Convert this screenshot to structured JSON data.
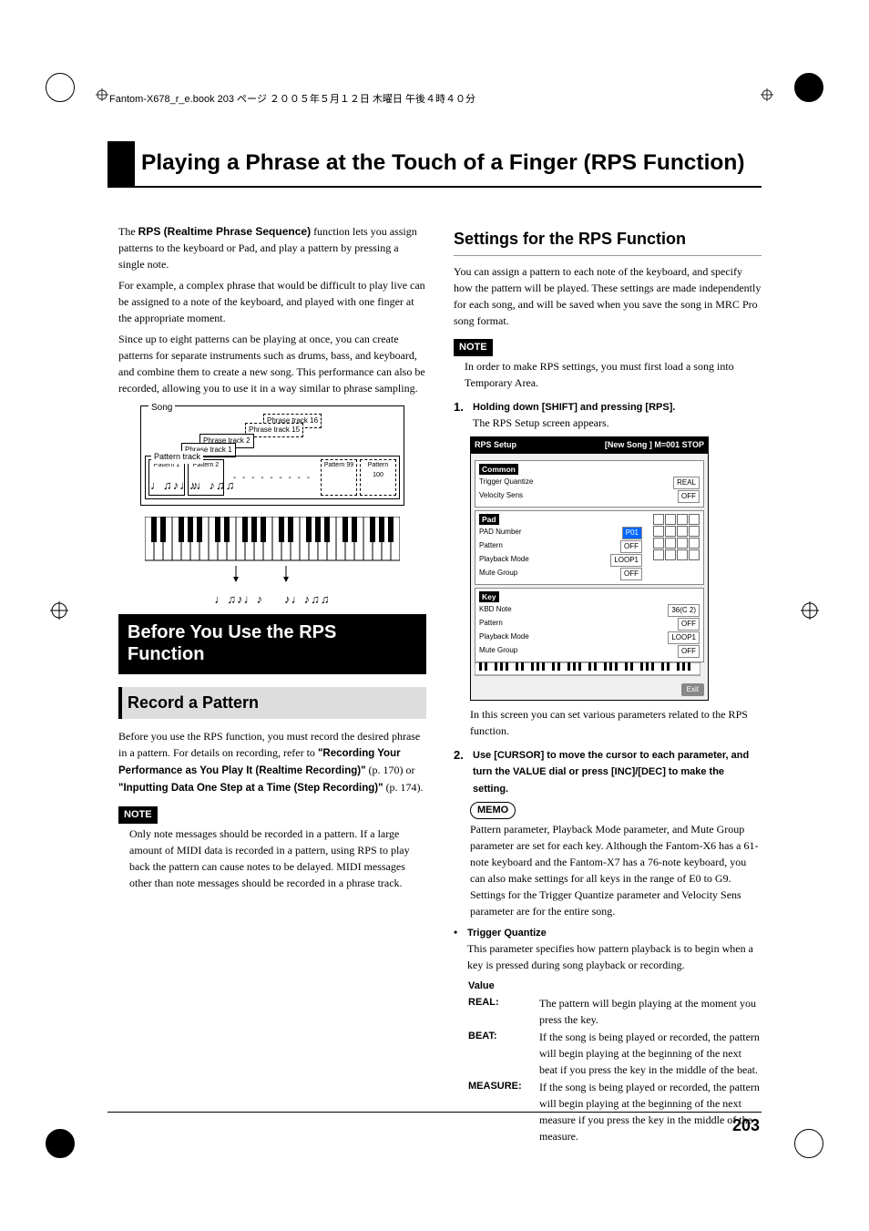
{
  "header": "Fantom-X678_r_e.book 203 ページ ２００５年５月１２日 木曜日 午後４時４０分",
  "title": "Playing a Phrase at the Touch of a Finger (RPS Function)",
  "page_number": "203",
  "left": {
    "intro_p1a": "The ",
    "intro_bold": "RPS (Realtime Phrase Sequence)",
    "intro_p1b": " function lets you assign patterns to the keyboard or Pad, and play a pattern by pressing a single note.",
    "intro_p2": "For example, a complex phrase that would be difficult to play live can be assigned to a note of the keyboard, and played with one finger at the appropriate moment.",
    "intro_p3": "Since up to eight patterns can be playing at once, you can create patterns for separate instruments such as drums, bass, and keyboard, and combine them to create a new song. This performance can also be recorded, allowing you to use it in a way similar to phrase sampling.",
    "diagram": {
      "song": "Song",
      "phrase_tracks": [
        "Phrase track 16",
        "Phrase track 15",
        "Phrase track 2",
        "Phrase track 1"
      ],
      "pattern_track": "Pattern track",
      "patterns": [
        "Pattern 1",
        "Pattern 2",
        "Pattern 99",
        "Pattern 100"
      ],
      "notes1": "♩♫♪♩♪",
      "notes2": "♪♩♪♫♫"
    },
    "h1": "Before You Use the RPS Function",
    "h2": "Record a Pattern",
    "rec_p1a": "Before you use the RPS function, you must record the desired phrase in a pattern. For details on recording, refer to ",
    "rec_q1": "\"Recording Your Performance as You Play It (Realtime Recording)\"",
    "rec_p1b": " (p. 170) or ",
    "rec_q2": "\"Inputting Data One Step at a Time (Step Recording)\"",
    "rec_p1c": " (p. 174).",
    "note_label": "NOTE",
    "note_text": "Only note messages should be recorded in a pattern. If a large amount of MIDI data is recorded in a pattern, using RPS to play back the pattern can cause notes to be delayed. MIDI messages other than note messages should be recorded in a phrase track."
  },
  "right": {
    "h2": "Settings for the RPS Function",
    "p1": "You can assign a pattern to each note of the keyboard, and specify how the pattern will be played. These settings are made independently for each song, and will be saved when you save the song in MRC Pro song format.",
    "note_label": "NOTE",
    "note_text": "In order to make RPS settings, you must first load a song into Temporary Area.",
    "step1_num": "1.",
    "step1_head": "Holding down [SHIFT] and pressing [RPS].",
    "step1_body": "The RPS Setup screen appears.",
    "screenshot": {
      "title": "RPS Setup",
      "song": "[New Song         ] M=001  STOP",
      "common_label": "Common",
      "common_rows": [
        {
          "k": "Trigger Quantize",
          "v": "REAL"
        },
        {
          "k": "Velocity Sens",
          "v": "OFF"
        }
      ],
      "pad_label": "Pad",
      "pad_rows": [
        {
          "k": "PAD Number",
          "v": "P01"
        },
        {
          "k": "Pattern",
          "v": "OFF"
        },
        {
          "k": "Playback Mode",
          "v": "LOOP1"
        },
        {
          "k": "Mute Group",
          "v": "OFF"
        }
      ],
      "key_label": "Key",
      "key_rows": [
        {
          "k": "KBD Note",
          "v": "36(C 2)"
        },
        {
          "k": "Pattern",
          "v": "OFF"
        },
        {
          "k": "Playback Mode",
          "v": "LOOP1"
        },
        {
          "k": "Mute Group",
          "v": "OFF"
        }
      ],
      "exit": "Exit"
    },
    "after_shot": "In this screen you can set various parameters related to the RPS function.",
    "step2_num": "2.",
    "step2_head": "Use [CURSOR] to move the cursor to each parameter, and turn the VALUE dial or press [INC]/[DEC] to make the setting.",
    "memo_label": "MEMO",
    "memo_text": "Pattern parameter, Playback Mode parameter, and Mute Group parameter are set for each key. Although the Fantom-X6 has a 61-note keyboard and the Fantom-X7 has a 76-note keyboard, you can also make settings for all keys in the range of E0 to G9. Settings for the Trigger Quantize parameter and Velocity Sens parameter are for the entire song.",
    "tq_label": "Trigger Quantize",
    "tq_desc": "This parameter specifies how pattern playback is to begin when a key is pressed during song playback or recording.",
    "value_label": "Value",
    "values": [
      {
        "k": "REAL:",
        "d": "The pattern will begin playing at the moment you press the key."
      },
      {
        "k": "BEAT:",
        "d": "If the song is being played or recorded, the pattern will begin playing at the beginning of the next beat if you press the key in the middle of the beat."
      },
      {
        "k": "MEASURE:",
        "d": "If the song is being played or recorded, the pattern will begin playing at the beginning of the next measure if you press the key in the middle of the measure."
      }
    ]
  }
}
